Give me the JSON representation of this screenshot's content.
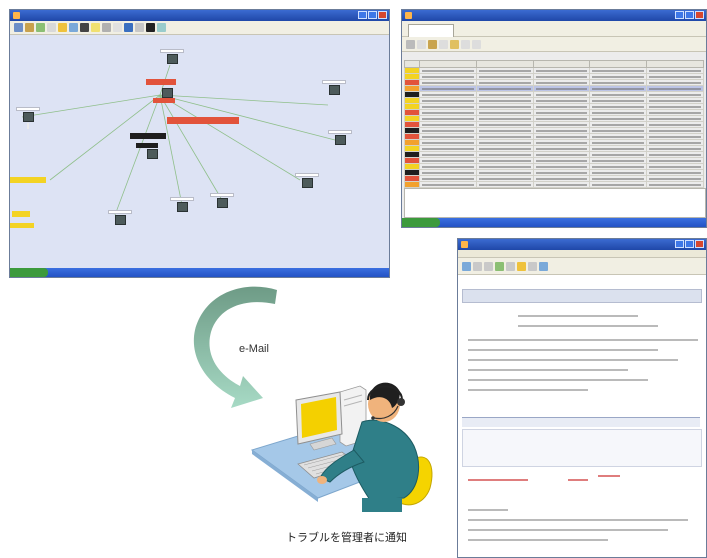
{
  "email_label": "e-Mail",
  "caption": "トラブルを管理者に通知",
  "colors": {
    "arrow_dark": "#6e9b86",
    "arrow_light": "#a7dac5",
    "severity_critical": "#e2533b",
    "severity_warning": "#f3d323",
    "severity_down": "#1e1e1e"
  },
  "icons": [
    "network-node-icon",
    "monitor-icon",
    "operator-headset-icon",
    "email-arrow-icon"
  ]
}
